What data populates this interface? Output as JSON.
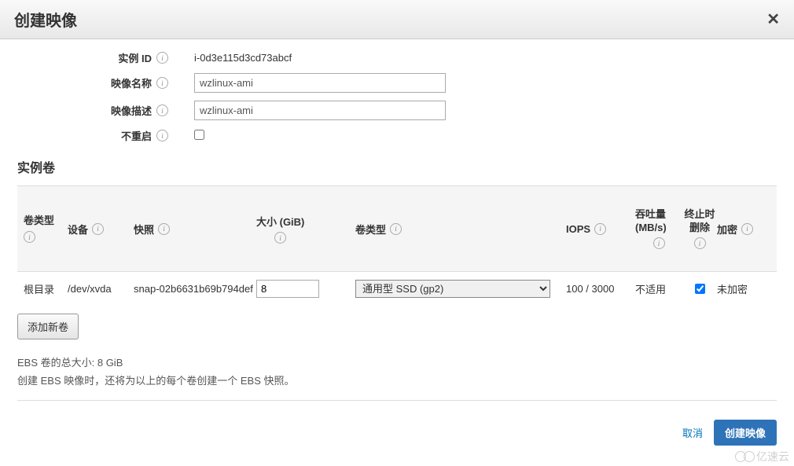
{
  "header": {
    "title": "创建映像"
  },
  "form": {
    "instanceId": {
      "label": "实例 ID",
      "value": "i-0d3e115d3cd73abcf"
    },
    "imageName": {
      "label": "映像名称",
      "value": "wzlinux-ami"
    },
    "imageDesc": {
      "label": "映像描述",
      "value": "wzlinux-ami"
    },
    "noReboot": {
      "label": "不重启",
      "checked": false
    }
  },
  "volumes": {
    "sectionTitle": "实例卷",
    "headers": {
      "volType": "卷类型",
      "device": "设备",
      "snapshot": "快照",
      "size": "大小 (GiB)",
      "volKind": "卷类型",
      "iops": "IOPS",
      "throughput": "吞吐量 (MB/s)",
      "delOnTerm": "终止时删除",
      "encryption": "加密"
    },
    "row": {
      "volType": "根目录",
      "device": "/dev/xvda",
      "snapshot": "snap-02b6631b69b794def",
      "size": "8",
      "volKind": "通用型 SSD (gp2)",
      "iops": "100 / 3000",
      "throughput": "不适用",
      "delOnTerm": true,
      "encryption": "未加密"
    },
    "addButton": "添加新卷",
    "helpLine1": "EBS 卷的总大小: 8 GiB",
    "helpLine2": "创建 EBS 映像时，还将为以上的每个卷创建一个 EBS 快照。"
  },
  "footer": {
    "cancel": "取消",
    "create": "创建映像"
  },
  "watermark": "亿速云"
}
